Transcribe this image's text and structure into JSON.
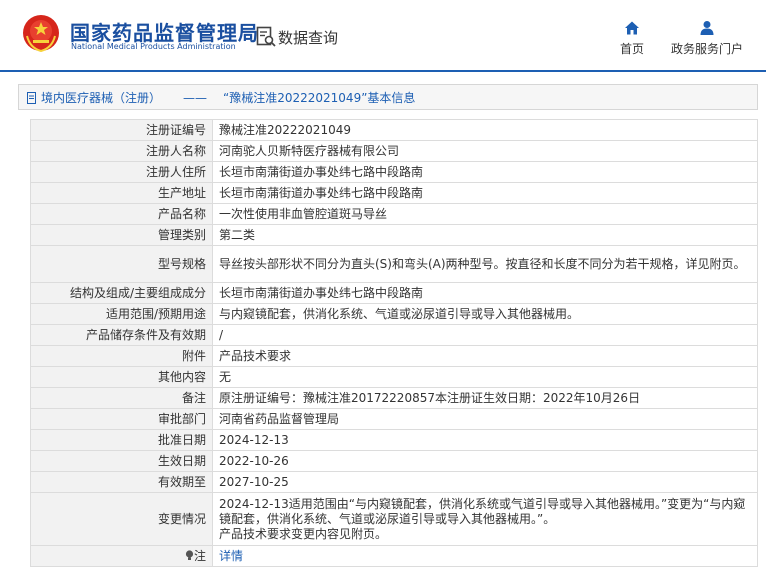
{
  "header": {
    "site_name": "国家药品监督管理局",
    "site_name_en": "National Medical Products Administration",
    "query_label": "数据查询",
    "nav": [
      {
        "label": "首页",
        "icon": "home-icon"
      },
      {
        "label": "政务服务门户",
        "icon": "person-icon"
      }
    ]
  },
  "breadcrumb": {
    "link": "境内医疗器械（注册）",
    "separator": "——",
    "title": "“豫械注准20222021049”基本信息"
  },
  "rows": [
    {
      "label": "注册证编号",
      "value": "豫械注准20222021049"
    },
    {
      "label": "注册人名称",
      "value": "河南驼人贝斯特医疗器械有限公司"
    },
    {
      "label": "注册人住所",
      "value": "长垣市南蒲街道办事处纬七路中段路南"
    },
    {
      "label": "生产地址",
      "value": "长垣市南蒲街道办事处纬七路中段路南"
    },
    {
      "label": "产品名称",
      "value": "一次性使用非血管腔道斑马导丝"
    },
    {
      "label": "管理类别",
      "value": "第二类"
    },
    {
      "label": "型号规格",
      "value": "导丝按头部形状不同分为直头(S)和弯头(A)两种型号。按直径和长度不同分为若干规格，详见附页。"
    },
    {
      "label": "结构及组成/主要组成成分",
      "value": "长垣市南蒲街道办事处纬七路中段路南"
    },
    {
      "label": "适用范围/预期用途",
      "value": "与内窥镜配套，供消化系统、气道或泌尿道引导或导入其他器械用。"
    },
    {
      "label": "产品储存条件及有效期",
      "value": "/"
    },
    {
      "label": "附件",
      "value": "产品技术要求"
    },
    {
      "label": "其他内容",
      "value": "无"
    },
    {
      "label": "备注",
      "value": "原注册证编号：豫械注准20172220857本注册证生效日期：2022年10月26日"
    },
    {
      "label": "审批部门",
      "value": "河南省药品监督管理局"
    },
    {
      "label": "批准日期",
      "value": "2024-12-13"
    },
    {
      "label": "生效日期",
      "value": "2022-10-26"
    },
    {
      "label": "有效期至",
      "value": "2027-10-25"
    },
    {
      "label": "变更情况",
      "value": "2024-12-13适用范围由“与内窥镜配套，供消化系统或气道引导或导入其他器械用。”变更为“与内窥镜配套，供消化系统、气道或泌尿道引导或导入其他器械用。”。\n产品技术要求变更内容见附页。"
    },
    {
      "label": "注",
      "value": "详情",
      "icon": "bulb-icon"
    }
  ]
}
